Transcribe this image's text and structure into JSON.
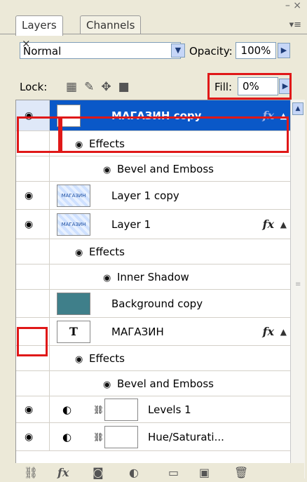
{
  "panel": {
    "tabs": [
      "Layers ×",
      "Channels"
    ],
    "top_controls": "– ×",
    "menu_icon_label": "▾≡",
    "blend_mode": "Normal",
    "opacity_label": "Opacity:",
    "opacity_value": "100%",
    "lock_label": "Lock:",
    "fill_label": "Fill:",
    "fill_value": "0%"
  },
  "layers": [
    {
      "name": "МАГАЗИН copy",
      "visible": true,
      "selected": true,
      "fx": "fx",
      "thumb": "white"
    },
    {
      "sub": "Effects",
      "indent": 1
    },
    {
      "sub": "Bevel and Emboss",
      "indent": 2
    },
    {
      "name": "Layer 1 copy",
      "visible": true,
      "fx": "",
      "thumb": "pattern",
      "thumb_text": "МАГАЗИН"
    },
    {
      "name": "Layer 1",
      "visible": true,
      "fx": "fx",
      "thumb": "pattern",
      "thumb_text": "МАГАЗИН"
    },
    {
      "sub": "Effects",
      "indent": 1
    },
    {
      "sub": "Inner Shadow",
      "indent": 2
    },
    {
      "name": "Background copy",
      "visible": false,
      "fx": "",
      "thumb": "teal"
    },
    {
      "name": "МАГАЗИН",
      "visible": false,
      "fx": "fx",
      "thumb": "text"
    },
    {
      "sub": "Effects",
      "indent": 1
    },
    {
      "sub": "Bevel and Emboss",
      "indent": 2
    },
    {
      "name": "Levels 1",
      "visible": true,
      "fx": "",
      "thumb": "adjust"
    },
    {
      "name": "Hue/Saturati...",
      "visible": true,
      "fx": "",
      "thumb": "adjust"
    }
  ],
  "thumb_text_T": "T",
  "icons": {
    "eye": "eye-icon",
    "lock_transparent": "checker",
    "lock_brush": "brush",
    "lock_move": "move",
    "lock_all": "lock"
  },
  "colors": {
    "selection": "#0a58c8",
    "highlight_box": "#e01818"
  }
}
